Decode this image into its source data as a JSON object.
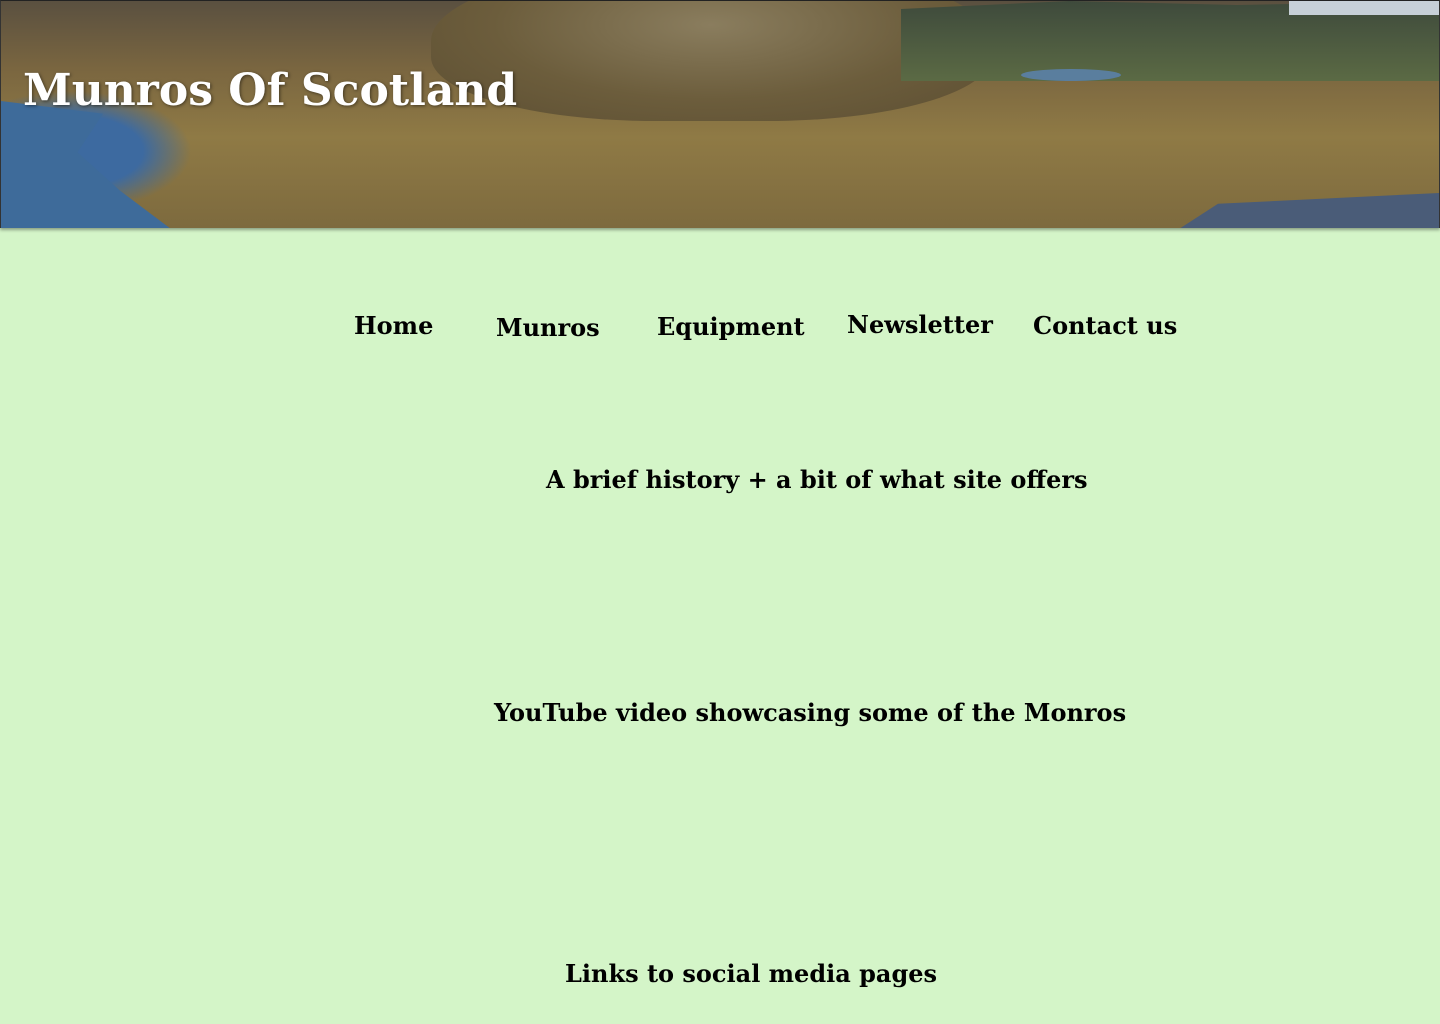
{
  "header": {
    "title": "Munros Of Scotland"
  },
  "nav": {
    "items": [
      {
        "label": "Home"
      },
      {
        "label": "Munros"
      },
      {
        "label": "Equipment"
      },
      {
        "label": "Newsletter"
      },
      {
        "label": "Contact us"
      }
    ]
  },
  "main": {
    "history_text": "A brief history + a bit of what site offers",
    "video_text": "YouTube video showcasing some of the Monros",
    "social_text": "Links to social media pages"
  },
  "colors": {
    "background": "#d4f5c8",
    "title_text": "#ffffff",
    "body_text": "#000000"
  }
}
